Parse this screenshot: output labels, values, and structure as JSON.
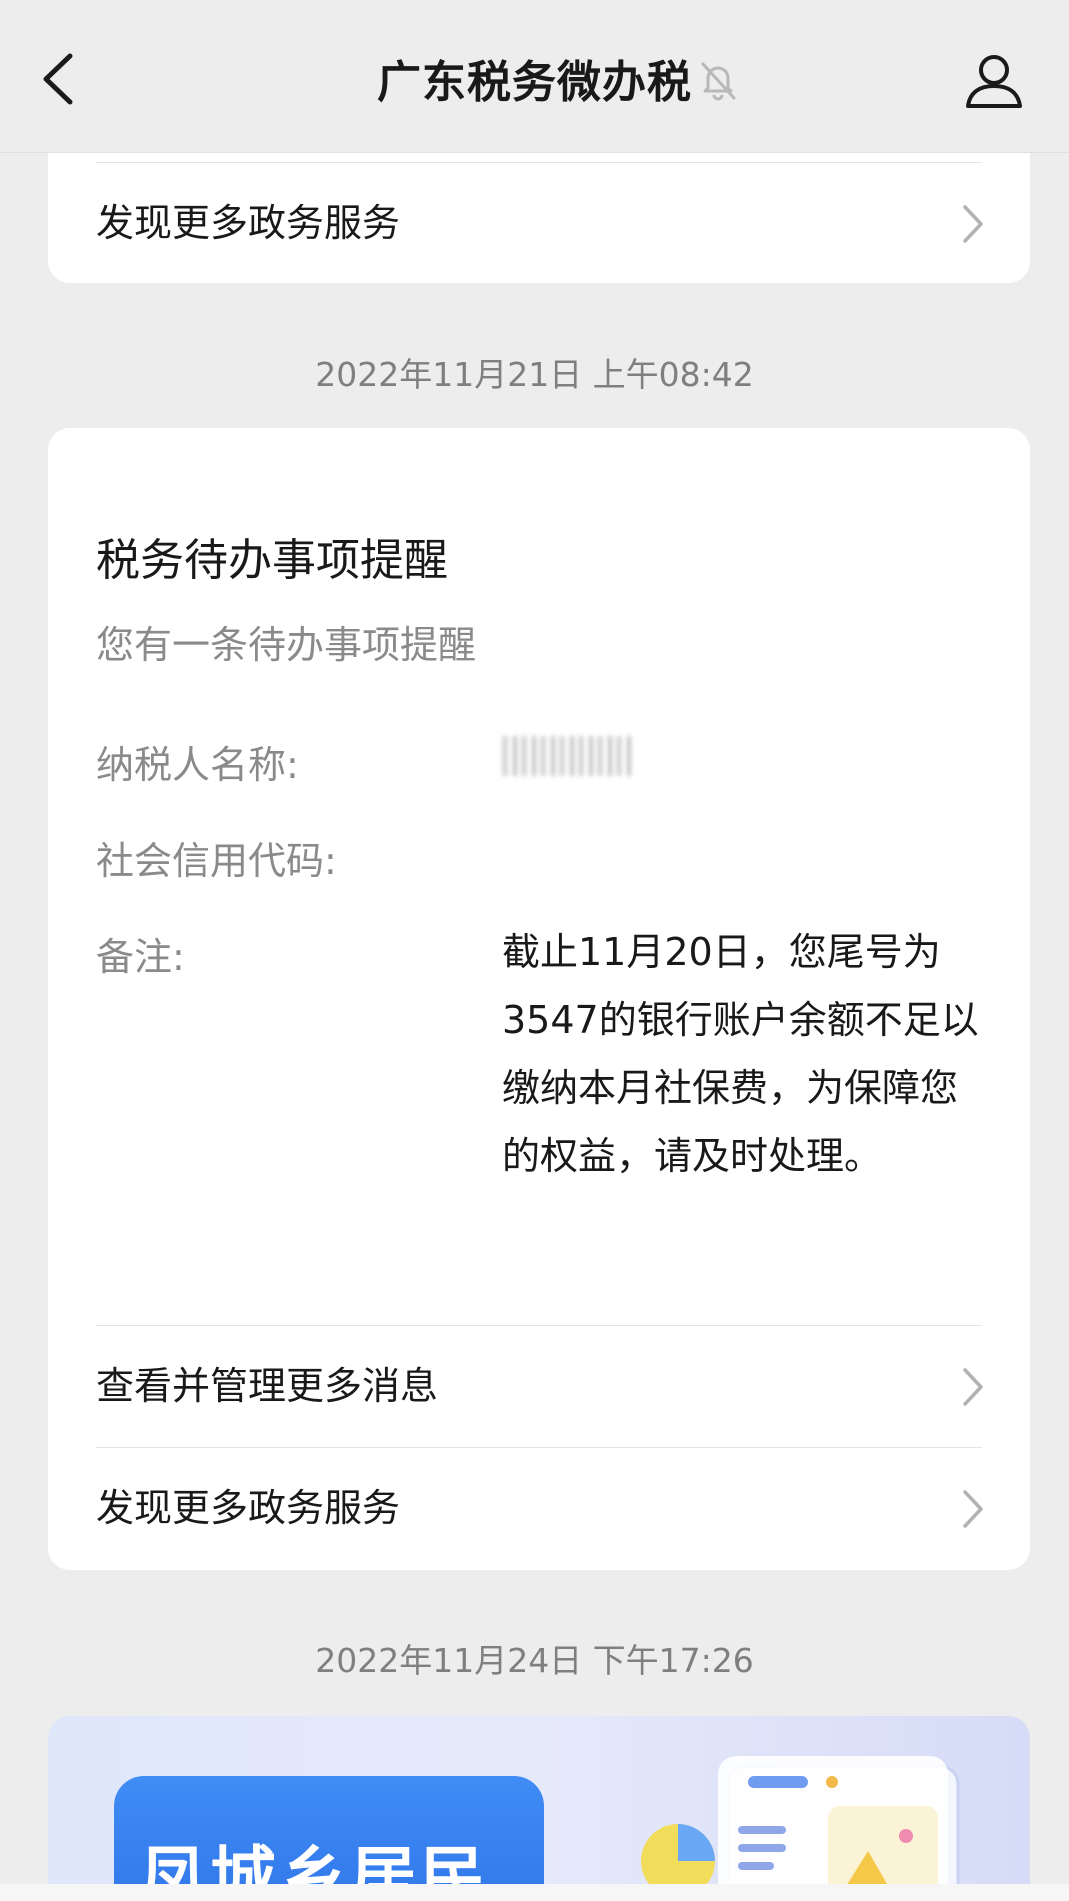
{
  "header": {
    "title": "广东税务微办税",
    "back_icon": "chevron-left-icon",
    "mute_icon": "bell-off-icon",
    "profile_icon": "person-icon"
  },
  "top_card": {
    "discover_label": "发现更多政务服务"
  },
  "timestamps": {
    "first": "2022年11月21日 上午08:42",
    "second": "2022年11月24日 下午17:26"
  },
  "message": {
    "title": "税务待办事项提醒",
    "subtitle": "您有一条待办事项提醒",
    "fields": {
      "taxpayer_label": "纳税人名称:",
      "credit_code_label": "社会信用代码:",
      "remark_label": "备注:",
      "remark_value": "截止11月20日，您尾号为3547的银行账户余额不足以缴纳本月社保费，为保障您的权益，请及时处理。"
    },
    "links": {
      "manage_label": "查看并管理更多消息",
      "discover_label": "发现更多政务服务"
    }
  },
  "banner": {
    "text": "凤城乡居民"
  },
  "colors": {
    "background": "#ededed",
    "card": "#ffffff",
    "muted_text": "#8a8a8a",
    "banner_blue": "#2f72e8"
  }
}
